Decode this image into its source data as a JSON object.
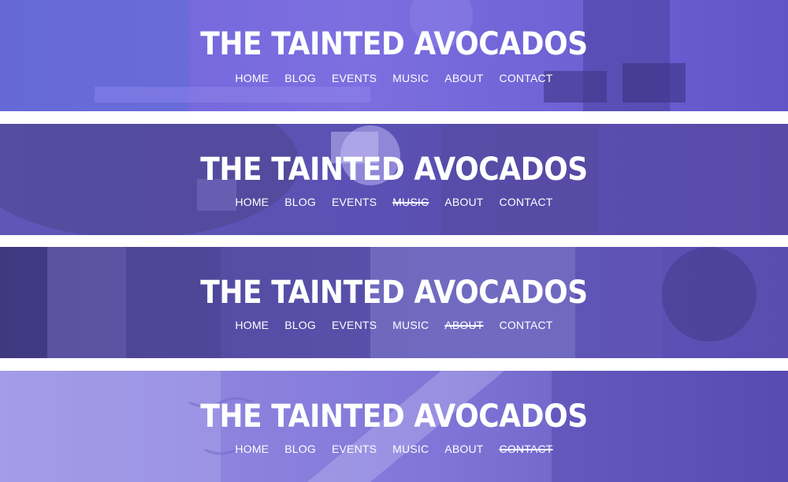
{
  "colors": {
    "tint": "#6b5fd1",
    "tint_dark": "#5b4db8",
    "text": "#ffffff",
    "divider": "#ffffff"
  },
  "banners": [
    {
      "title": "THE TAINTED AVOCADOS",
      "nav": [
        "HOME",
        "BLOG",
        "EVENTS",
        "MUSIC",
        "ABOUT",
        "CONTACT"
      ],
      "active": ""
    },
    {
      "title": "THE TAINTED AVOCADOS",
      "nav": [
        "HOME",
        "BLOG",
        "EVENTS",
        "MUSIC",
        "ABOUT",
        "CONTACT"
      ],
      "active": "MUSIC"
    },
    {
      "title": "THE TAINTED AVOCADOS",
      "nav": [
        "HOME",
        "BLOG",
        "EVENTS",
        "MUSIC",
        "ABOUT",
        "CONTACT"
      ],
      "active": "ABOUT"
    },
    {
      "title": "THE TAINTED AVOCADOS",
      "nav": [
        "HOME",
        "BLOG",
        "EVENTS",
        "MUSIC",
        "ABOUT",
        "CONTACT"
      ],
      "active": "CONTACT"
    }
  ]
}
